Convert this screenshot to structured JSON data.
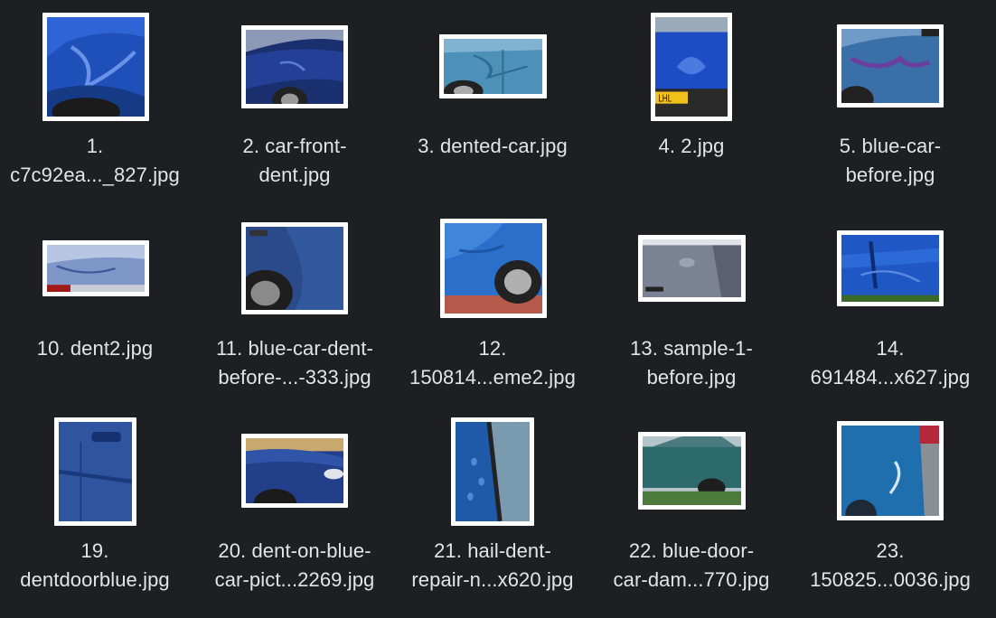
{
  "files": [
    {
      "caption": "1.\nc7c92ea..._827.jpg",
      "thumbnail_icon": "blue-car-dent-photo"
    },
    {
      "caption": "2. car-front-\ndent.jpg",
      "thumbnail_icon": "blue-car-dent-photo"
    },
    {
      "caption": "3. dented-car.jpg",
      "thumbnail_icon": "light-blue-car-door-photo"
    },
    {
      "caption": "4. 2.jpg",
      "thumbnail_icon": "blue-car-rear-plate-photo"
    },
    {
      "caption": "5. blue-car-\nbefore.jpg",
      "thumbnail_icon": "blue-car-dent-photo"
    },
    {
      "caption": "10. dent2.jpg",
      "thumbnail_icon": "car-dent-closeup-photo"
    },
    {
      "caption": "11. blue-car-dent-\nbefore-...-333.jpg",
      "thumbnail_icon": "blue-car-wheel-photo"
    },
    {
      "caption": "12.\n150814...eme2.jpg",
      "thumbnail_icon": "blue-car-wheel-photo"
    },
    {
      "caption": "13. sample-1-\nbefore.jpg",
      "thumbnail_icon": "grey-car-door-photo"
    },
    {
      "caption": "14.\n691484...x627.jpg",
      "thumbnail_icon": "blue-panel-crease-photo"
    },
    {
      "caption": "19.\ndentdoorblue.jpg",
      "thumbnail_icon": "blue-door-handle-photo"
    },
    {
      "caption": "20. dent-on-blue-\ncar-pict...2269.jpg",
      "thumbnail_icon": "blue-car-front-photo"
    },
    {
      "caption": "21. hail-dent-\nrepair-n...x620.jpg",
      "thumbnail_icon": "hail-dent-pillar-photo"
    },
    {
      "caption": "22. blue-door-\ncar-dam...770.jpg",
      "thumbnail_icon": "teal-car-side-photo"
    },
    {
      "caption": "23.\n150825...0036.jpg",
      "thumbnail_icon": "blue-car-rear-corner-photo"
    }
  ],
  "colors": {
    "background": "#1e1f22",
    "caption_text": "#e4e4e6",
    "thumbnail_border": "#ffffff"
  }
}
